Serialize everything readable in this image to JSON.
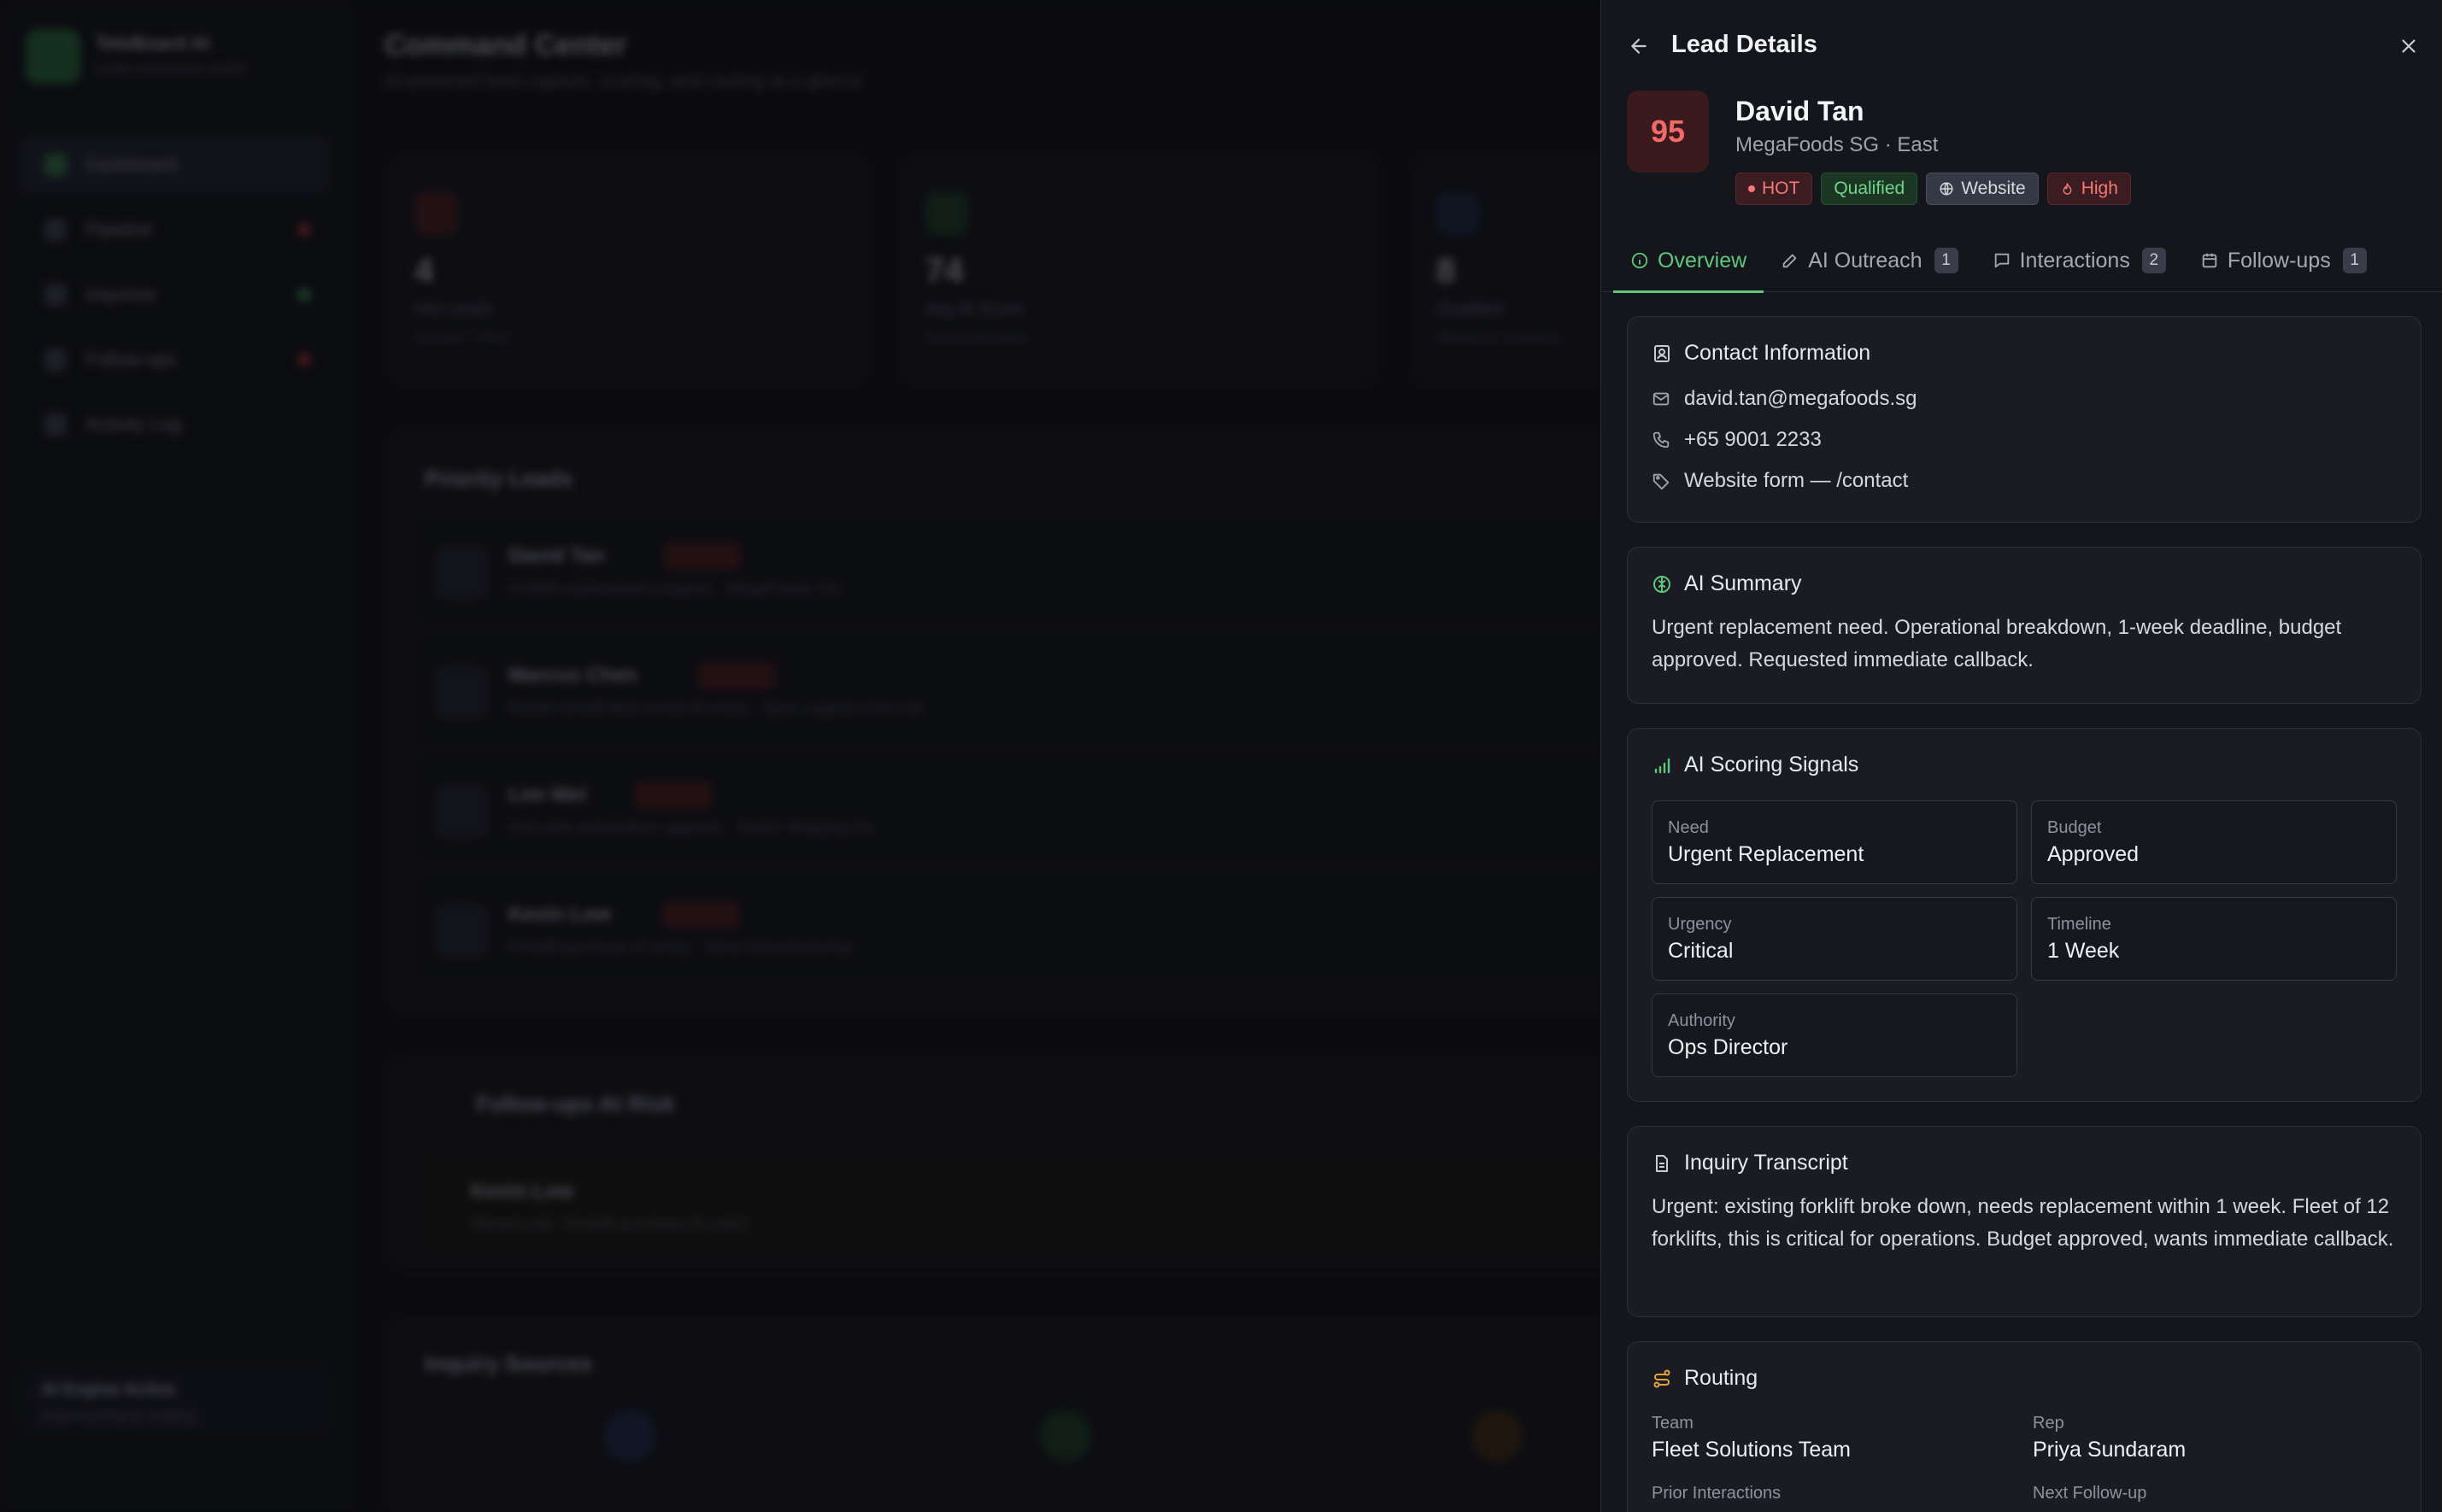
{
  "background": {
    "brand": "TeleBoard AI",
    "brand_sub": "Lead command center",
    "nav": [
      "Dashboard",
      "Pipeline",
      "Inquiries",
      "Follow-ups",
      "Activity Log"
    ],
    "page_title": "Command Center",
    "page_sub": "AI-powered lead capture, scoring, and routing at a glance",
    "stats": [
      {
        "value": "4",
        "label": "Hot Leads",
        "sub": "Scored > 75 AI"
      },
      {
        "value": "74",
        "label": "Avg AI Score",
        "sub": "Across all leads"
      },
      {
        "value": "8",
        "label": "Qualified",
        "sub": "Ready for outreach"
      }
    ],
    "priority_title": "Priority Leads",
    "priority_rows": [
      {
        "name": "David Tan",
        "desc": "Forklift replacement (urgent) · MegaFoods SG"
      },
      {
        "name": "Marcus Chen",
        "desc": "Reefer forklift fleet rental (8 units) · Apex Logistics Pte Ltd"
      },
      {
        "name": "Lim Wei",
        "desc": "Port-side automation upgrade · Orient Shipping Co"
      },
      {
        "name": "Kevin Low",
        "desc": "Forklift purchase (5 units) · Nexa Manufacturing"
      }
    ],
    "followup_title": "Follow-ups At Risk",
    "followup_row": {
      "name": "Kevin Low",
      "desc": "Missed call · Forklift purchase (5 units)"
    },
    "sources_title": "Inquiry Sources",
    "agent_status": "AI Engine Active",
    "agent_sub": "Auto-scoring & routing"
  },
  "drawer": {
    "title": "Lead Details",
    "lead": {
      "score": "95",
      "name": "David Tan",
      "company": "MegaFoods SG · East",
      "badges": {
        "hot": "HOT",
        "qualified": "Qualified",
        "source": "Website",
        "priority": "High"
      }
    },
    "tabs": [
      {
        "label": "Overview",
        "count": ""
      },
      {
        "label": "AI Outreach",
        "count": "1"
      },
      {
        "label": "Interactions",
        "count": "2"
      },
      {
        "label": "Follow-ups",
        "count": "1"
      }
    ],
    "contact": {
      "title": "Contact Information",
      "email": "david.tan@megafoods.sg",
      "phone": "+65 9001 2233",
      "source": "Website form — /contact"
    },
    "summary": {
      "title": "AI Summary",
      "text": "Urgent replacement need. Operational breakdown, 1-week deadline, budget approved. Requested immediate callback."
    },
    "signals": {
      "title": "AI Scoring Signals",
      "items": [
        {
          "key": "Need",
          "value": "Urgent Replacement"
        },
        {
          "key": "Budget",
          "value": "Approved"
        },
        {
          "key": "Urgency",
          "value": "Critical"
        },
        {
          "key": "Timeline",
          "value": "1 Week"
        },
        {
          "key": "Authority",
          "value": "Ops Director"
        }
      ]
    },
    "transcript": {
      "title": "Inquiry Transcript",
      "text": "Urgent: existing forklift broke down, needs replacement within 1 week. Fleet of 12 forklifts, this is critical for operations. Budget approved, wants immediate callback."
    },
    "routing": {
      "title": "Routing",
      "team_label": "Team",
      "team": "Fleet Solutions Team",
      "rep_label": "Rep",
      "rep": "Priya Sundaram",
      "prior_label": "Prior Interactions",
      "next_label": "Next Follow-up"
    }
  },
  "colors": {
    "accent": "#5cc77d",
    "hot": "#f47878",
    "warn": "#e8a33d"
  }
}
